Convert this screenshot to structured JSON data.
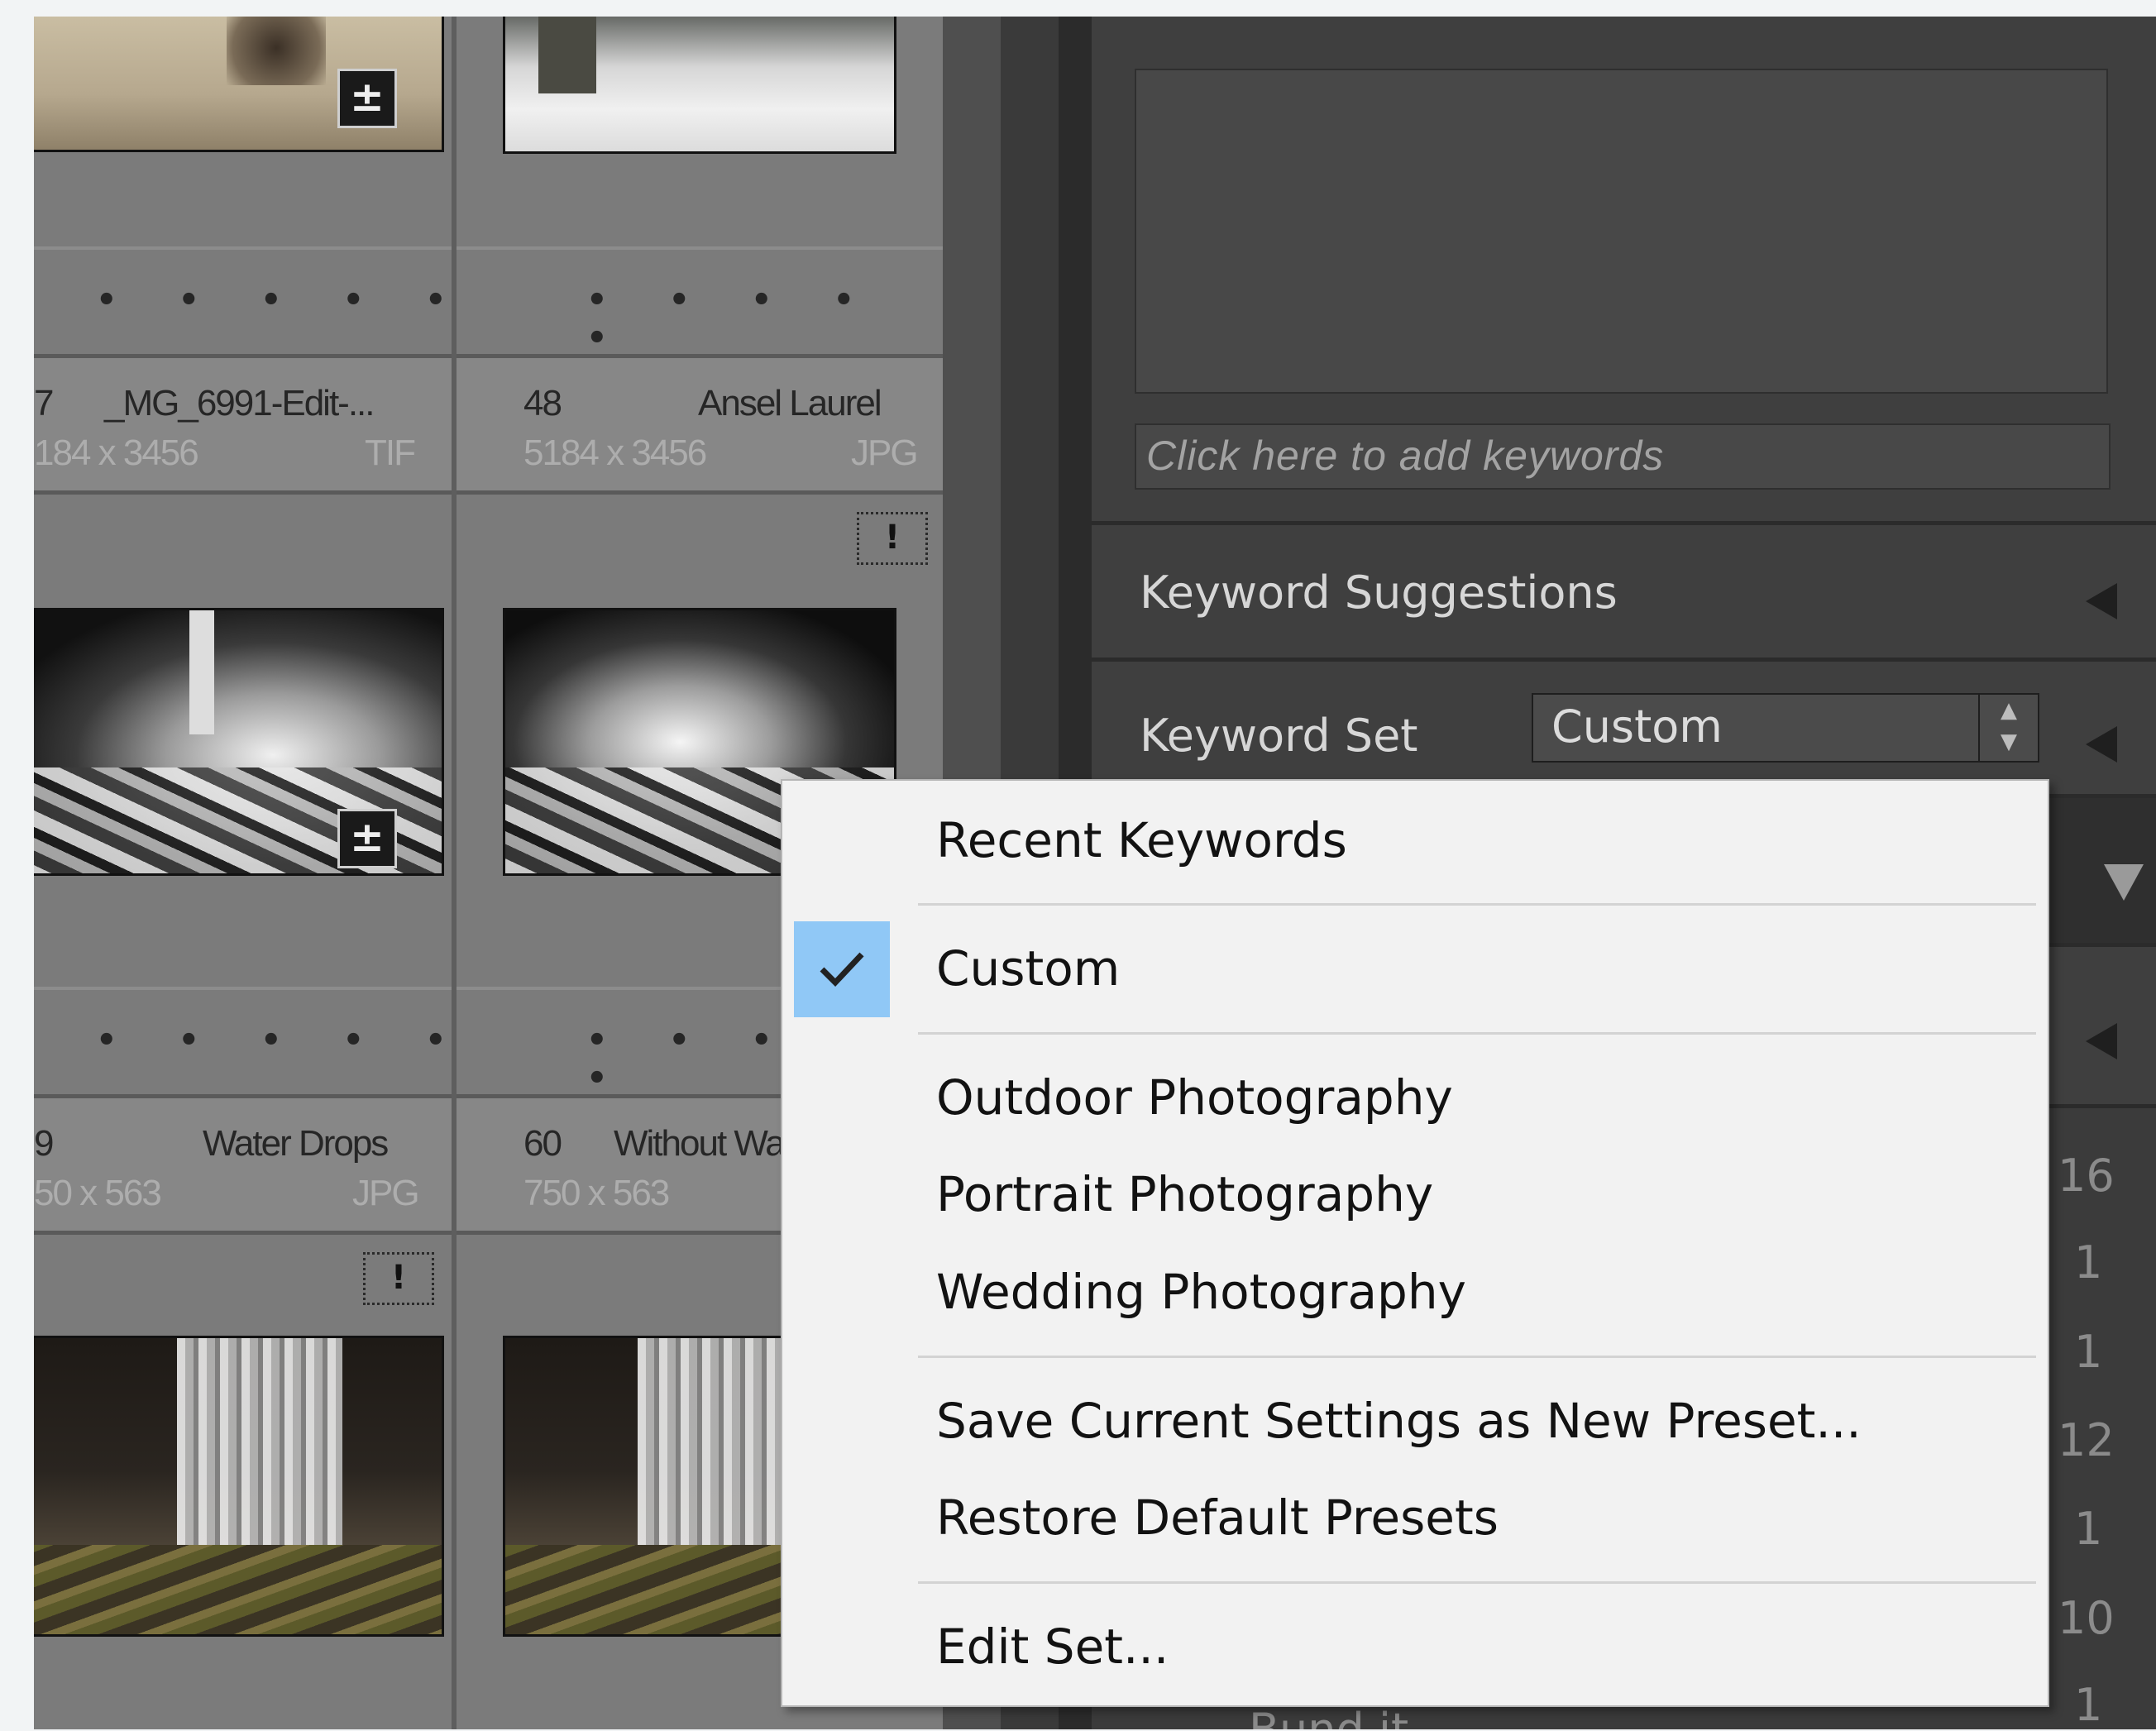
{
  "grid": {
    "rows": [
      {
        "left": {
          "num": "7",
          "name": "_MG_6991-Edit-...",
          "dims": "184 x 3456",
          "type": "TIF"
        },
        "right": {
          "num": "48",
          "name": "Ansel Laurel",
          "dims": "5184 x 3456",
          "type": "JPG"
        }
      },
      {
        "left": {
          "num": "9",
          "name": "Water Drops",
          "dims": "50 x 563",
          "type": "JPG"
        },
        "right": {
          "num": "60",
          "name": "Without Wa",
          "dims": "750 x 563",
          "type": ""
        }
      }
    ],
    "rating_dots": "• • • • •",
    "warning_glyph": "!"
  },
  "keywords": {
    "input_placeholder": "Click here to add keywords",
    "suggestions_label": "Keyword Suggestions",
    "set_label": "Keyword Set",
    "set_value": "Custom",
    "list_counts": [
      "16",
      "1",
      "1",
      "12",
      "1",
      "10",
      "1"
    ],
    "list_partial_text": "Bund.it"
  },
  "menu": {
    "items": [
      {
        "label": "Recent Keywords",
        "checked": false
      },
      {
        "label": "Custom",
        "checked": true
      },
      {
        "label": "Outdoor Photography",
        "checked": false
      },
      {
        "label": "Portrait Photography",
        "checked": false
      },
      {
        "label": "Wedding Photography",
        "checked": false
      },
      {
        "label": "Save Current Settings as New Preset...",
        "checked": false
      },
      {
        "label": "Restore Default Presets",
        "checked": false
      },
      {
        "label": "Edit Set...",
        "checked": false
      }
    ],
    "check_color": "#90c8f6"
  },
  "icons": [
    "edit-badge-icon",
    "warning-icon",
    "collapse-left-icon",
    "expand-down-icon",
    "checkmark-icon",
    "stepper-icon"
  ]
}
